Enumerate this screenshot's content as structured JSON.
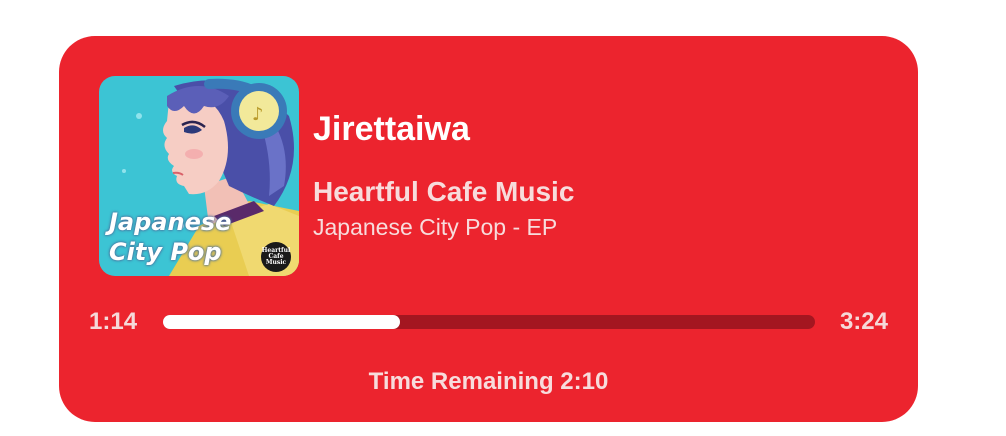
{
  "player": {
    "track_title": "Jirettaiwa",
    "artist": "Heartful Cafe Music",
    "album": "Japanese City Pop - EP",
    "cover": {
      "line1": "Japanese",
      "line2": "City Pop",
      "logo_line1": "Heartful",
      "logo_line2": "Cafe",
      "logo_line3": "Music"
    },
    "time_current": "1:14",
    "time_total": "3:24",
    "progress": 0.363,
    "remaining_text": "Time Remaining 2:10"
  },
  "colors": {
    "card_background": "#ec242e",
    "progress_track": "#a41620",
    "progress_fill": "#ffffff"
  }
}
